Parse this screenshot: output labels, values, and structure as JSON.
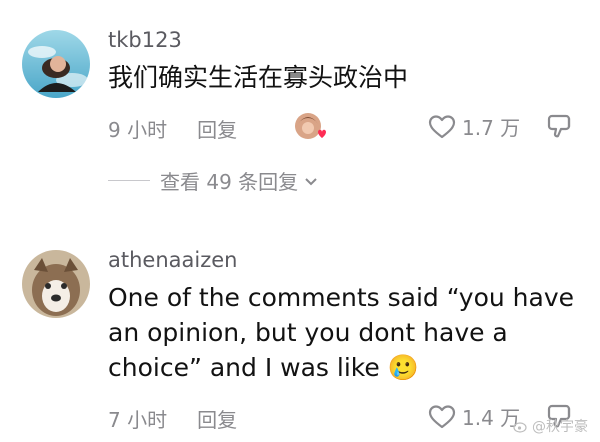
{
  "comments": [
    {
      "username": "tkb123",
      "text": "我们确实生活在寡头政治中",
      "time": "9 小时",
      "reply_label": "回复",
      "likes": "1.7 万",
      "creator_liked": true
    },
    {
      "username": "athenaaizen",
      "text": "One of the comments said “you have an opinion, but you dont have a choice” and I was like",
      "emoji": "🥲",
      "time": "7 小时",
      "reply_label": "回复",
      "likes": "1.4 万"
    }
  ],
  "view_replies": "查看 49 条回复",
  "watermark": "@秋宇豪",
  "colors": {
    "muted": "#8a8a8e",
    "text": "#121212",
    "heart": "#fe2c55"
  }
}
